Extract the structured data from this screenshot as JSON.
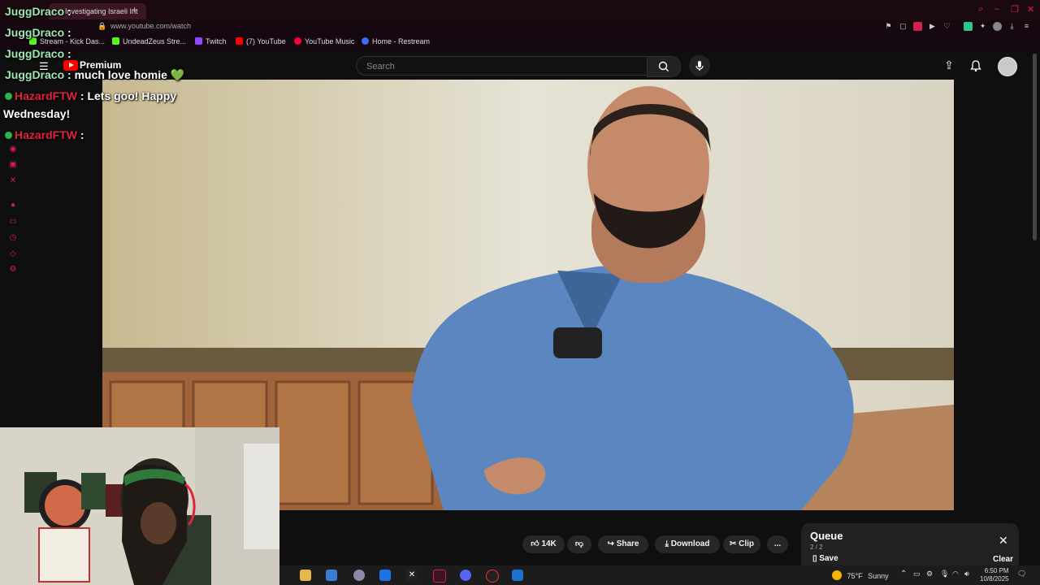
{
  "browser": {
    "tab_title": "Investigating Israeli Int",
    "new_tab_symbol": "+",
    "url": "www.youtube.com/watch",
    "bookmarks": [
      {
        "label": "Stream - Kick Das..."
      },
      {
        "label": "UndeadZeus Stre..."
      },
      {
        "label": "Twitch"
      },
      {
        "label": "(7) YouTube"
      },
      {
        "label": "YouTube Music"
      },
      {
        "label": "Home - Restream"
      }
    ]
  },
  "youtube": {
    "brand": "Premium",
    "search_placeholder": "Search",
    "actions": {
      "like_count": "14K",
      "share": "Share",
      "download": "Download",
      "clip": "Clip",
      "more": "..."
    },
    "queue": {
      "title": "Queue",
      "position": "2 / 2",
      "save": "Save",
      "clear": "Clear"
    }
  },
  "chat": [
    {
      "user": "JuggDraco",
      "sep": " :",
      "message": ""
    },
    {
      "user": "JuggDraco",
      "sep": " :",
      "message": ""
    },
    {
      "user": "JuggDraco",
      "sep": " :",
      "message": ""
    },
    {
      "user": "JuggDraco",
      "sep": " :",
      "message": " much love homie 💚"
    },
    {
      "user": "HazardFTW",
      "sep": " :",
      "message": " Lets goo! Happy"
    },
    {
      "user": "",
      "sep": "",
      "message": "Wednesday!"
    },
    {
      "user": "HazardFTW",
      "sep": " :",
      "message": ""
    }
  ],
  "taskbar": {
    "weather_temp": "75°F",
    "weather_desc": "Sunny",
    "time": "6:50 PM",
    "date": "10/8/2025"
  },
  "colors": {
    "youtube_red": "#ff0000",
    "chat_user_green": "#9fe8b4",
    "chat_user_red": "#e0243c",
    "badge_green": "#2bb34c",
    "browser_accent": "#d0224a"
  }
}
